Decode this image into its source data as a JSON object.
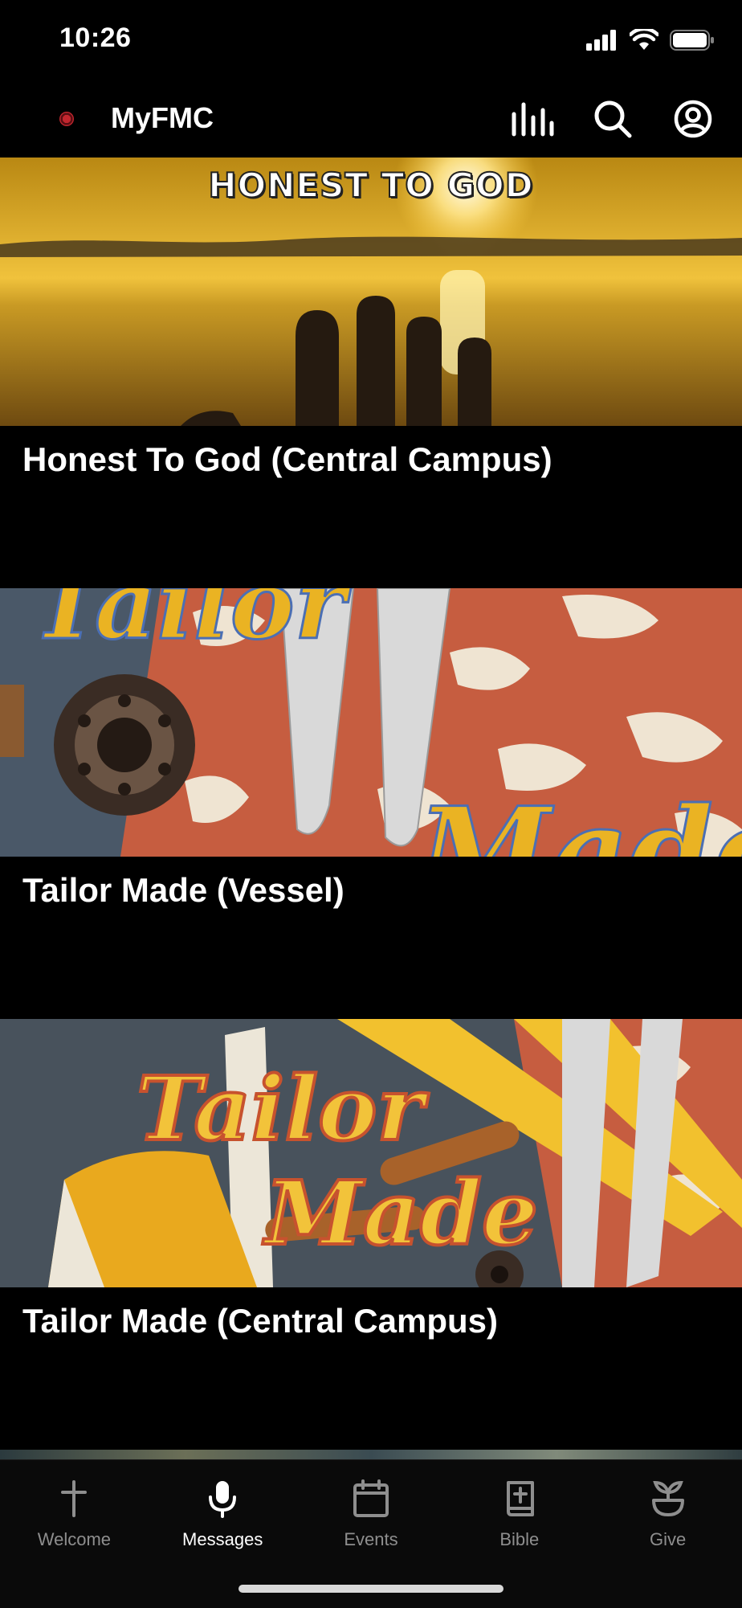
{
  "status": {
    "time": "10:26"
  },
  "header": {
    "app_title": "MyFMC",
    "icons": [
      "equalizer-icon",
      "search-icon",
      "profile-icon"
    ]
  },
  "cards": [
    {
      "title": "Honest To God (Central Campus)",
      "image_text": "HONEST TO GOD"
    },
    {
      "title": "Tailor Made (Vessel)"
    },
    {
      "title": "Tailor Made (Central Campus)",
      "image_text": [
        "Tailor",
        "Made"
      ]
    }
  ],
  "tabs": [
    {
      "label": "Welcome",
      "icon": "cross-icon"
    },
    {
      "label": "Messages",
      "icon": "microphone-icon",
      "active": true
    },
    {
      "label": "Events",
      "icon": "calendar-icon"
    },
    {
      "label": "Bible",
      "icon": "bible-icon"
    },
    {
      "label": "Give",
      "icon": "plant-icon"
    }
  ]
}
